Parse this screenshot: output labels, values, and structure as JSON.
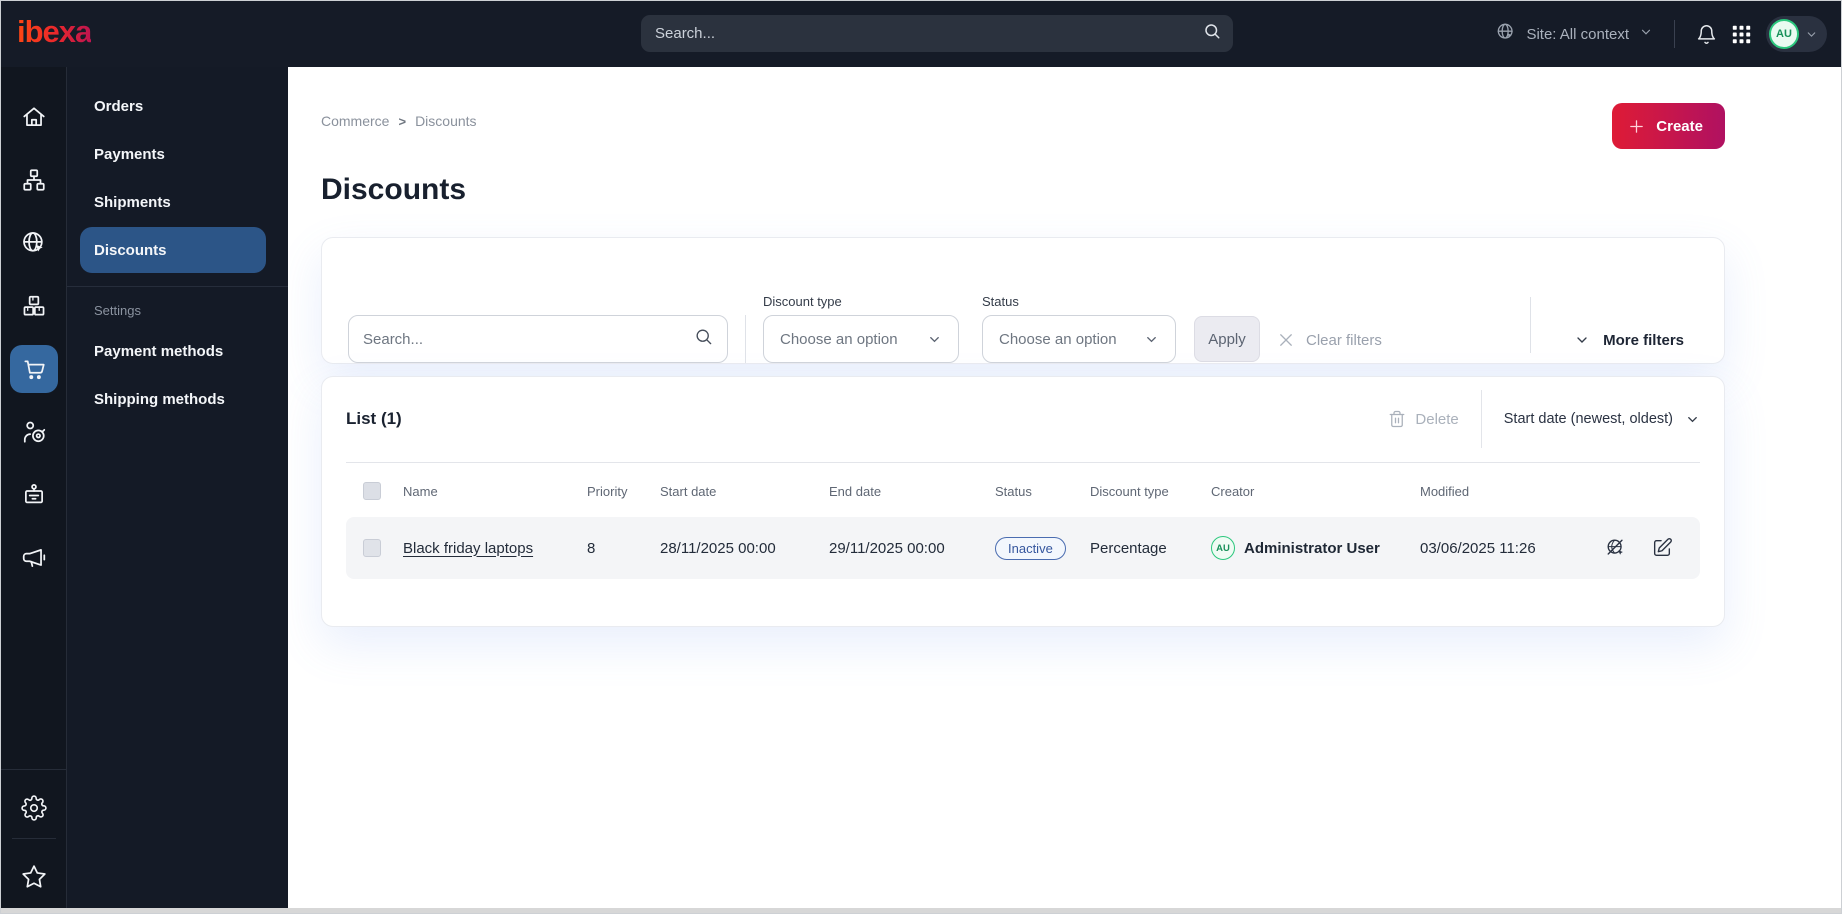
{
  "topbar": {
    "logo_text": "ibexa",
    "search_placeholder": "Search...",
    "site_context_label": "Site: All context",
    "avatar_initials": "AU"
  },
  "sidebar": {
    "icons": [
      "home",
      "content-tree",
      "site",
      "products",
      "commerce",
      "customers",
      "personnel",
      "marketing"
    ],
    "active_icon": "commerce",
    "bottom_icons": [
      "settings",
      "favorites"
    ]
  },
  "nav": {
    "items": [
      {
        "label": "Orders"
      },
      {
        "label": "Payments"
      },
      {
        "label": "Shipments"
      },
      {
        "label": "Discounts"
      }
    ],
    "active_item": "Discounts",
    "settings_label": "Settings",
    "settings_items": [
      {
        "label": "Payment methods"
      },
      {
        "label": "Shipping methods"
      }
    ]
  },
  "page": {
    "breadcrumb": {
      "crumb1": "Commerce",
      "separator": ">",
      "crumb2": "Discounts"
    },
    "title": "Discounts",
    "create_label": "Create"
  },
  "filters": {
    "search_placeholder": "Search...",
    "discount_type_label": "Discount type",
    "discount_type_value": "Choose an option",
    "status_label": "Status",
    "status_value": "Choose an option",
    "apply_label": "Apply",
    "clear_label": "Clear filters",
    "more_label": "More filters"
  },
  "list": {
    "title": "List (1)",
    "delete_label": "Delete",
    "sort_label": "Start date (newest, oldest)",
    "columns": {
      "name": "Name",
      "priority": "Priority",
      "start_date": "Start date",
      "end_date": "End date",
      "status": "Status",
      "discount_type": "Discount type",
      "creator": "Creator",
      "modified": "Modified"
    },
    "rows": [
      {
        "name": "Black friday laptops",
        "priority": "8",
        "start_date": "28/11/2025 00:00",
        "end_date": "29/11/2025 00:00",
        "status": "Inactive",
        "discount_type": "Percentage",
        "creator_initials": "AU",
        "creator_name": "Administrator User",
        "modified": "03/06/2025 11:26"
      }
    ]
  },
  "colors": {
    "topbar_bg": "#151b27",
    "sidebar_bg": "#11161f",
    "panel_bg": "#141a26",
    "active_item_bg": "#2c5587",
    "active_icon_bg": "#35689f",
    "brand_gradient_start": "#ff4713",
    "brand_gradient_end": "#bd1550",
    "create_gradient_start": "#de1b36",
    "create_gradient_end": "#b01161",
    "status_inactive": "#35569e",
    "avatar_green": "#2bc77d"
  }
}
